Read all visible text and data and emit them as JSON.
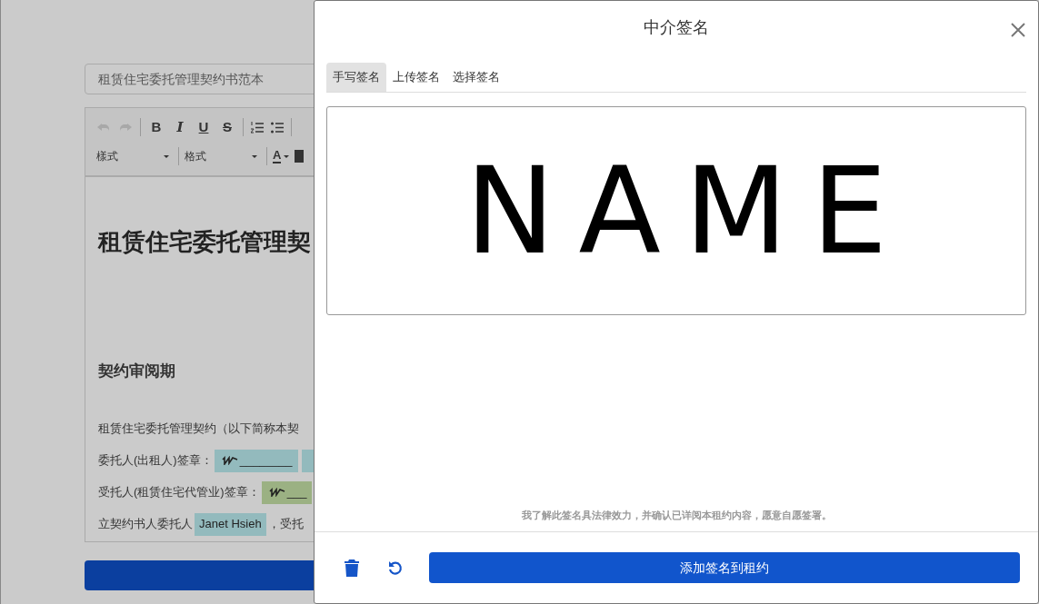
{
  "background": {
    "template_select": {
      "value": "租赁住宅委托管理契约书范本"
    },
    "toolbar": {
      "history": [
        {
          "kind": "undo",
          "disabled": true
        },
        {
          "kind": "redo",
          "disabled": true
        }
      ],
      "format_buttons": [
        {
          "kind": "bold",
          "label": "B"
        },
        {
          "kind": "italic",
          "label": "I"
        },
        {
          "kind": "underline",
          "label": "U"
        },
        {
          "kind": "strike",
          "label": "S"
        }
      ],
      "dropdowns": [
        {
          "label": "樣式"
        },
        {
          "label": "格式"
        }
      ],
      "text_color_button": {
        "label": "A"
      }
    },
    "document": {
      "title": "租赁住宅委托管理契",
      "section_heading": "契约审阅期",
      "lines": [
        [
          {
            "kind": "text",
            "text": "租赁住宅委托管理契约（以下简称本契"
          }
        ],
        [
          {
            "kind": "text",
            "text": "委托人(出租人)签章："
          },
          {
            "kind": "signature",
            "text": "________",
            "color": "#93babd"
          },
          {
            "kind": "field",
            "color": "#93babd"
          }
        ],
        [
          {
            "kind": "text",
            "text": "受托人(租赁住宅代管业)签章："
          },
          {
            "kind": "signature",
            "text": "___",
            "color": "#9bb183"
          }
        ],
        [
          {
            "kind": "text",
            "text": "立契约书人委托人"
          },
          {
            "kind": "field",
            "text": "Janet Hsieh",
            "color": "#93babd"
          },
          {
            "kind": "text",
            "text": "，受托"
          }
        ]
      ]
    }
  },
  "dialog": {
    "title": "中介签名",
    "tabs": [
      {
        "label": "手写签名",
        "selected": true
      },
      {
        "label": "上传签名",
        "selected": false
      },
      {
        "label": "选择签名",
        "selected": false
      }
    ],
    "signature_pad": {
      "signature": "NAME"
    },
    "notice": "我了解此签名具法律效力，并确认已详阅本租约内容，愿意自愿签署。",
    "submit_button": "添加签名到租约"
  }
}
